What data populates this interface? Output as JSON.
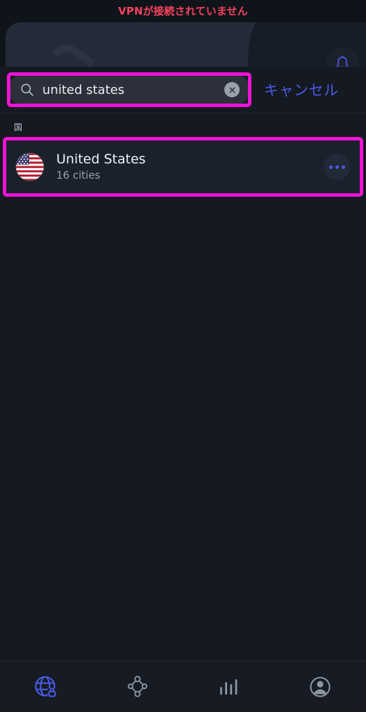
{
  "status_banner": {
    "text": "VPNが接続されていません",
    "color": "#f2425c"
  },
  "header": {
    "notification_icon": "bell-icon"
  },
  "search": {
    "value": "united states",
    "placeholder": "検索",
    "search_icon": "search-icon",
    "clear_icon": "clear-circle-icon",
    "cancel_label": "キャンセル",
    "cancel_color": "#4a5ce8"
  },
  "results": {
    "section_label": "国",
    "items": [
      {
        "flag": "us-flag-icon",
        "title": "United States",
        "subtitle": "16 cities",
        "more_icon": "more-horizontal-icon"
      }
    ]
  },
  "tabbar": {
    "active_index": 0,
    "active_color": "#4a5ce8",
    "inactive_color": "#8e95a3",
    "items": [
      {
        "name": "tab-vpn",
        "icon": "globe-lock-icon"
      },
      {
        "name": "tab-network",
        "icon": "mesh-network-icon"
      },
      {
        "name": "tab-stats",
        "icon": "bar-chart-icon"
      },
      {
        "name": "tab-account",
        "icon": "account-circle-icon"
      }
    ]
  },
  "highlight": {
    "color": "#f213d6"
  }
}
